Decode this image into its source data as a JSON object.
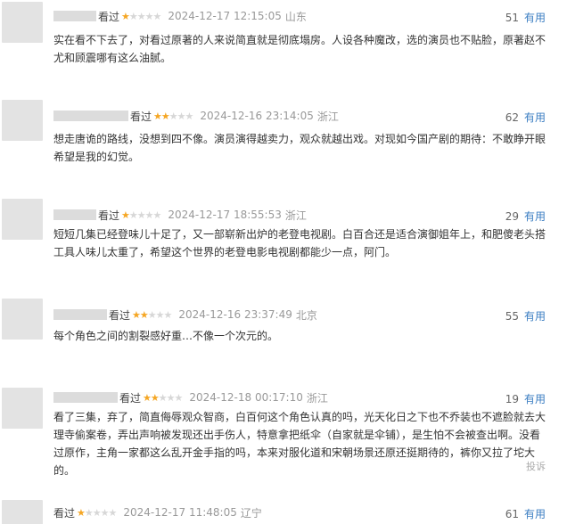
{
  "reviews": [
    {
      "status": "看过",
      "stars": 1,
      "time": "2024-12-17 12:15:05",
      "location": "山东",
      "useful_count": "51",
      "useful_label": "有用",
      "content": "实在看不下去了，对看过原著的人来说简直就是彻底塌房。人设各种魔改，选的演员也不贴脸，原著赵不尤和顾震哪有这么油腻。"
    },
    {
      "status": "看过",
      "stars": 2,
      "time": "2024-12-16 23:14:05",
      "location": "浙江",
      "useful_count": "62",
      "useful_label": "有用",
      "content": "想走唐诡的路线，没想到四不像。演员演得越卖力，观众就越出戏。对现如今国产剧的期待：不敢睁开眼希望是我的幻觉。"
    },
    {
      "status": "看过",
      "stars": 1,
      "time": "2024-12-17 18:55:53",
      "location": "浙江",
      "useful_count": "29",
      "useful_label": "有用",
      "content": "短短几集已经登味儿十足了，又一部崭新出炉的老登电视剧。白百合还是适合演御姐年上，和肥傻老头搭工具人味儿太重了，希望这个世界的老登电影电视剧都能少一点，阿门。"
    },
    {
      "status": "看过",
      "stars": 2,
      "time": "2024-12-16 23:37:49",
      "location": "北京",
      "useful_count": "55",
      "useful_label": "有用",
      "content": "每个角色之间的割裂感好重…不像一个次元的。"
    },
    {
      "status": "看过",
      "stars": 2,
      "time": "2024-12-18 00:17:10",
      "location": "浙江",
      "useful_count": "19",
      "useful_label": "有用",
      "content": "看了三集，弃了，简直侮辱观众智商，白百何这个角色认真的吗，光天化日之下也不乔装也不遮脸就去大理寺偷案卷，弄出声响被发现还出手伤人，特意拿把纸伞（自家就是伞铺），是生怕不会被查出啊。没看过原作，主角一家都这么乱开金手指的吗，本来对服化道和宋朝场景还原还挺期待的，裤你又拉了坨大的。",
      "report": "投诉"
    },
    {
      "status": "看过",
      "stars": 1,
      "time": "2024-12-17 11:48:05",
      "location": "辽宁",
      "useful_count": "61",
      "useful_label": "有用",
      "content": ""
    }
  ]
}
